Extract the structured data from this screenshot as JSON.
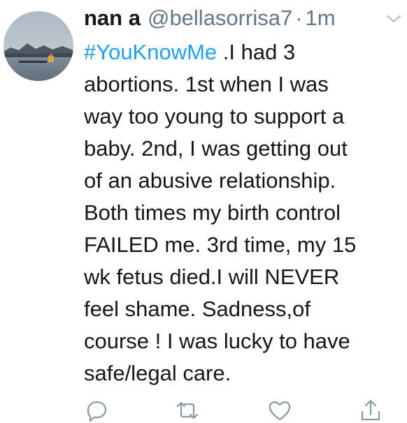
{
  "tweet": {
    "display_name": "nan a",
    "handle": "@bellasorrisa7",
    "separator": "·",
    "timestamp": "1m",
    "hashtag": "#YouKnowMe",
    "text_lines": [
      " .I had 3",
      "abortions. 1st when I was",
      "way too young to support a",
      "baby. 2nd, I was getting out",
      "of an abusive relationship.",
      "Both times my birth control",
      "FAILED me. 3rd time, my 15",
      "wk fetus died.I will NEVER",
      "feel shame. Sadness,of",
      "course ! I was lucky to have",
      "safe/legal care."
    ]
  },
  "actions": {
    "icons": [
      "reply-icon",
      "retweet-icon",
      "like-icon",
      "share-icon"
    ]
  },
  "colors": {
    "text": "#14171a",
    "secondary": "#657786",
    "link": "#1da1f2",
    "icon": "#8899a6"
  }
}
